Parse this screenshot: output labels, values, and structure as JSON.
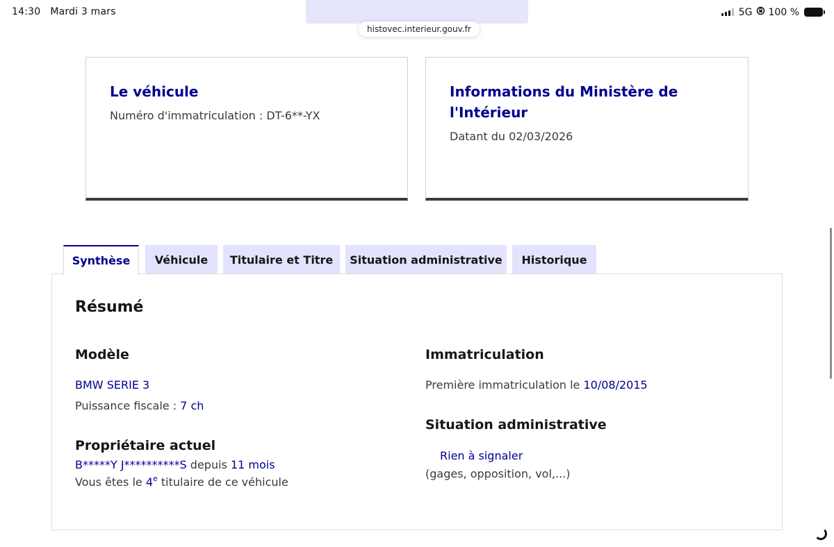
{
  "status_bar": {
    "time": "14:30",
    "date": "Mardi 3 mars",
    "network": "5G",
    "battery": "100 %"
  },
  "browser": {
    "url": "histovec.interieur.gouv.fr"
  },
  "vehicle_card": {
    "title": "Le véhicule",
    "plate_label": "Numéro d'immatriculation : DT-6**-YX"
  },
  "ministry_card": {
    "title": "Informations du Ministère de l'Intérieur",
    "date_text": "Datant du 02/03/2026"
  },
  "tabs": [
    {
      "label": "Synthèse",
      "active": true
    },
    {
      "label": "Véhicule",
      "active": false
    },
    {
      "label": "Titulaire et Titre",
      "active": false
    },
    {
      "label": "Situation administrative",
      "active": false
    },
    {
      "label": "Historique",
      "active": false
    }
  ],
  "summary": {
    "title": "Résumé",
    "model": {
      "heading": "Modèle",
      "name": "BMW SERIE 3",
      "fiscal_power_label": "Puissance fiscale : ",
      "fiscal_power_value": "7 ch"
    },
    "owner": {
      "heading": "Propriétaire actuel",
      "name": "B*****Y J**********S",
      "since_label": " depuis ",
      "since_value": "11 mois",
      "rank_prefix": "Vous êtes le ",
      "rank_number": "4",
      "rank_suffix": "e",
      "rank_rest": " titulaire de ce véhicule"
    },
    "registration": {
      "heading": "Immatriculation",
      "first_label": "Première immatriculation le ",
      "first_date": "10/08/2015"
    },
    "admin_situation": {
      "heading": "Situation administrative",
      "status": "Rien à signaler",
      "details": "(gages, opposition, vol,...)"
    }
  },
  "colors": {
    "accent": "#000091",
    "tab_bg": "#e3e3fd",
    "text": "#3a3a3a"
  }
}
